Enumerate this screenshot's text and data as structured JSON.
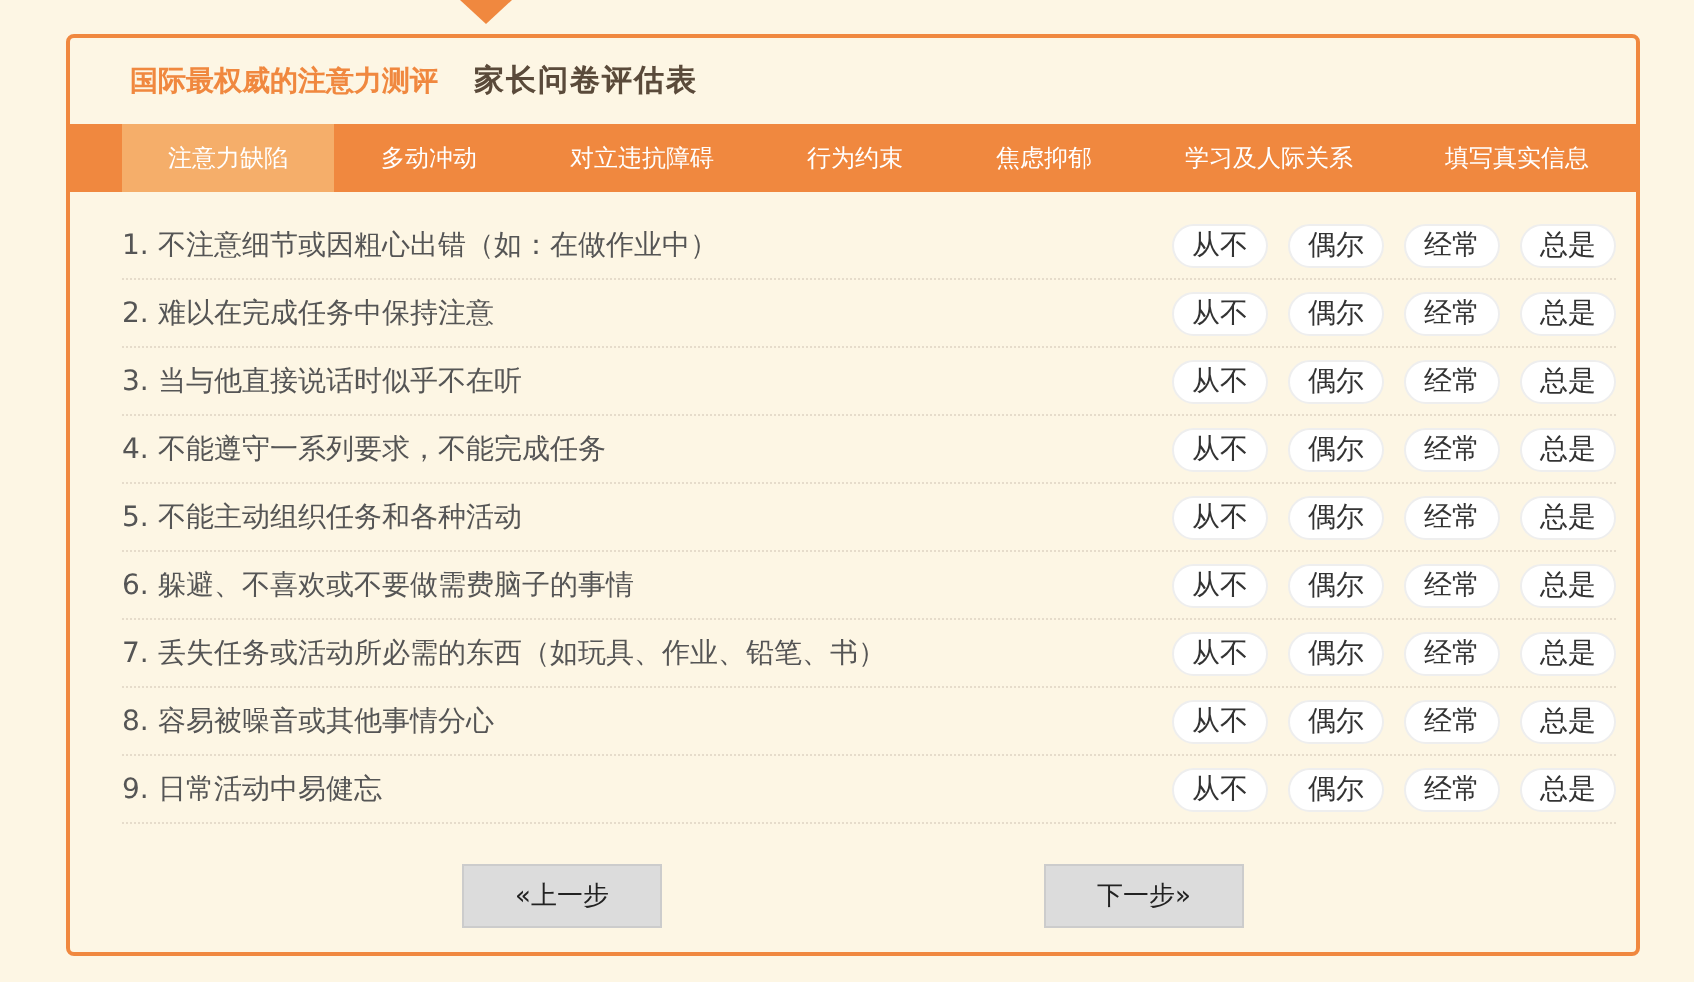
{
  "header": {
    "brand": "国际最权威的注意力测评",
    "title": "家长问卷评估表"
  },
  "tabs": [
    {
      "label": "注意力缺陷",
      "selected": true
    },
    {
      "label": "多动冲动",
      "selected": false
    },
    {
      "label": "对立违抗障碍",
      "selected": false
    },
    {
      "label": "行为约束",
      "selected": false
    },
    {
      "label": "焦虑抑郁",
      "selected": false
    },
    {
      "label": "学习及人际关系",
      "selected": false
    },
    {
      "label": "填写真实信息",
      "selected": false
    }
  ],
  "questions": [
    {
      "text": "1. 不注意细节或因粗心出错（如：在做作业中）",
      "options": [
        "从不",
        "偶尔",
        "经常",
        "总是"
      ]
    },
    {
      "text": "2. 难以在完成任务中保持注意",
      "options": [
        "从不",
        "偶尔",
        "经常",
        "总是"
      ]
    },
    {
      "text": "3. 当与他直接说话时似乎不在听",
      "options": [
        "从不",
        "偶尔",
        "经常",
        "总是"
      ]
    },
    {
      "text": "4. 不能遵守一系列要求，不能完成任务",
      "options": [
        "从不",
        "偶尔",
        "经常",
        "总是"
      ]
    },
    {
      "text": "5. 不能主动组织任务和各种活动",
      "options": [
        "从不",
        "偶尔",
        "经常",
        "总是"
      ]
    },
    {
      "text": "6. 躲避、不喜欢或不要做需费脑子的事情",
      "options": [
        "从不",
        "偶尔",
        "经常",
        "总是"
      ]
    },
    {
      "text": "7. 丢失任务或活动所必需的东西（如玩具、作业、铅笔、书）",
      "options": [
        "从不",
        "偶尔",
        "经常",
        "总是"
      ]
    },
    {
      "text": "8. 容易被噪音或其他事情分心",
      "options": [
        "从不",
        "偶尔",
        "经常",
        "总是"
      ]
    },
    {
      "text": "9. 日常活动中易健忘",
      "options": [
        "从不",
        "偶尔",
        "经常",
        "总是"
      ]
    }
  ],
  "buttons": {
    "prev": "«上一步",
    "next": "下一步»"
  }
}
